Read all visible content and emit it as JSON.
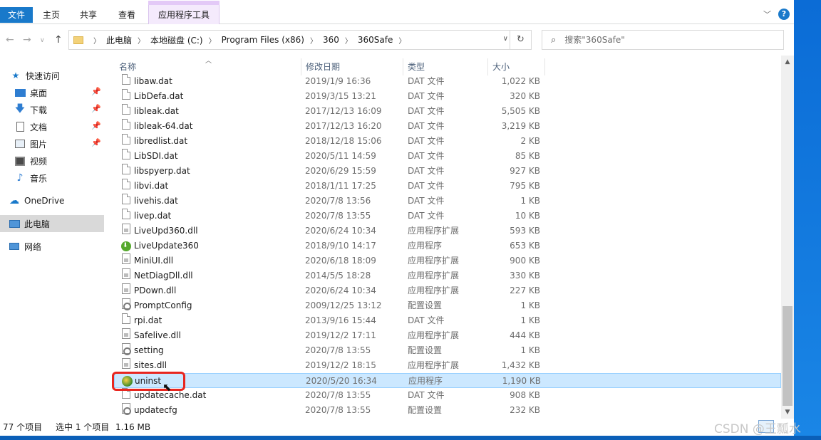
{
  "ribbon": {
    "tabs": [
      "文件",
      "主页",
      "共享",
      "查看",
      "应用程序工具"
    ],
    "help": "?"
  },
  "address": {
    "crumbs": [
      "此电脑",
      "本地磁盘 (C:)",
      "Program Files (x86)",
      "360",
      "360Safe"
    ],
    "search_placeholder": "搜索\"360Safe\""
  },
  "nav": {
    "items": [
      {
        "label": "快速访问",
        "icon": "star-icon"
      },
      {
        "label": "桌面",
        "icon": "desktop-icon",
        "pinned": true
      },
      {
        "label": "下载",
        "icon": "download-icon",
        "pinned": true
      },
      {
        "label": "文档",
        "icon": "document-icon",
        "pinned": true
      },
      {
        "label": "图片",
        "icon": "picture-icon",
        "pinned": true
      },
      {
        "label": "视频",
        "icon": "video-icon"
      },
      {
        "label": "音乐",
        "icon": "music-icon"
      },
      {
        "label": "OneDrive",
        "icon": "cloud-icon"
      },
      {
        "label": "此电脑",
        "icon": "computer-icon",
        "selected": true
      },
      {
        "label": "网络",
        "icon": "network-icon"
      }
    ]
  },
  "columns": {
    "name": "名称",
    "date": "修改日期",
    "type": "类型",
    "size": "大小"
  },
  "files": [
    {
      "name": "libaw.dat",
      "date": "2019/1/9 16:36",
      "type": "DAT 文件",
      "size": "1,022 KB",
      "icon": "doc"
    },
    {
      "name": "LibDefa.dat",
      "date": "2019/3/15 13:21",
      "type": "DAT 文件",
      "size": "320 KB",
      "icon": "doc"
    },
    {
      "name": "libleak.dat",
      "date": "2017/12/13 16:09",
      "type": "DAT 文件",
      "size": "5,505 KB",
      "icon": "doc"
    },
    {
      "name": "libleak-64.dat",
      "date": "2017/12/13 16:20",
      "type": "DAT 文件",
      "size": "3,219 KB",
      "icon": "doc"
    },
    {
      "name": "libredlist.dat",
      "date": "2018/12/18 15:06",
      "type": "DAT 文件",
      "size": "2 KB",
      "icon": "doc"
    },
    {
      "name": "LibSDI.dat",
      "date": "2020/5/11 14:59",
      "type": "DAT 文件",
      "size": "85 KB",
      "icon": "doc"
    },
    {
      "name": "libspyerp.dat",
      "date": "2020/6/29 15:59",
      "type": "DAT 文件",
      "size": "927 KB",
      "icon": "doc"
    },
    {
      "name": "libvi.dat",
      "date": "2018/1/11 17:25",
      "type": "DAT 文件",
      "size": "795 KB",
      "icon": "doc"
    },
    {
      "name": "livehis.dat",
      "date": "2020/7/8 13:56",
      "type": "DAT 文件",
      "size": "1 KB",
      "icon": "doc"
    },
    {
      "name": "livep.dat",
      "date": "2020/7/8 13:55",
      "type": "DAT 文件",
      "size": "10 KB",
      "icon": "doc"
    },
    {
      "name": "LiveUpd360.dll",
      "date": "2020/6/24 10:34",
      "type": "应用程序扩展",
      "size": "593 KB",
      "icon": "dll"
    },
    {
      "name": "LiveUpdate360",
      "date": "2018/9/10 14:17",
      "type": "应用程序",
      "size": "653 KB",
      "icon": "exe-green"
    },
    {
      "name": "MiniUI.dll",
      "date": "2020/6/18 18:09",
      "type": "应用程序扩展",
      "size": "900 KB",
      "icon": "dll"
    },
    {
      "name": "NetDiagDll.dll",
      "date": "2014/5/5 18:28",
      "type": "应用程序扩展",
      "size": "330 KB",
      "icon": "dll"
    },
    {
      "name": "PDown.dll",
      "date": "2020/6/24 10:34",
      "type": "应用程序扩展",
      "size": "227 KB",
      "icon": "dll"
    },
    {
      "name": "PromptConfig",
      "date": "2009/12/25 13:12",
      "type": "配置设置",
      "size": "1 KB",
      "icon": "cfg"
    },
    {
      "name": "rpi.dat",
      "date": "2013/9/16 15:44",
      "type": "DAT 文件",
      "size": "1 KB",
      "icon": "doc"
    },
    {
      "name": "Safelive.dll",
      "date": "2019/12/2 17:11",
      "type": "应用程序扩展",
      "size": "444 KB",
      "icon": "dll"
    },
    {
      "name": "setting",
      "date": "2020/7/8 13:55",
      "type": "配置设置",
      "size": "1 KB",
      "icon": "cfg"
    },
    {
      "name": "sites.dll",
      "date": "2019/12/2 18:15",
      "type": "应用程序扩展",
      "size": "1,432 KB",
      "icon": "dll"
    },
    {
      "name": "uninst",
      "date": "2020/5/20 16:34",
      "type": "应用程序",
      "size": "1,190 KB",
      "icon": "exe-uninst",
      "selected": true
    },
    {
      "name": "updatecache.dat",
      "date": "2020/7/8 13:55",
      "type": "DAT 文件",
      "size": "908 KB",
      "icon": "doc"
    },
    {
      "name": "updatecfg",
      "date": "2020/7/8 13:55",
      "type": "配置设置",
      "size": "232 KB",
      "icon": "cfg"
    }
  ],
  "status": {
    "count": "77 个项目",
    "selection": "选中 1 个项目",
    "size": "1.16 MB"
  },
  "watermark": "CSDN @王瓢水",
  "colors": {
    "accent": "#1979ca",
    "selection": "#cce8ff",
    "highlight_box": "#e8261f"
  }
}
